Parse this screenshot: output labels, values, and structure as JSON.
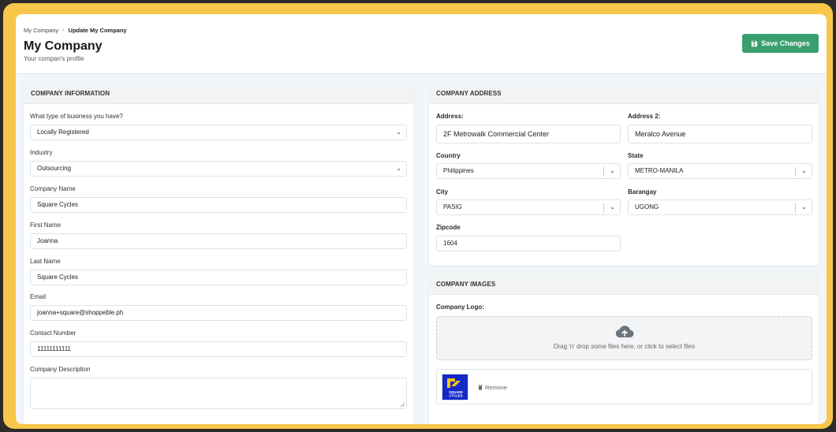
{
  "breadcrumb": {
    "root": "My Company",
    "separator": "›",
    "current": "Update My Company"
  },
  "header": {
    "title": "My Company",
    "subtitle": "Your compan's profile",
    "save_label": "Save Changes"
  },
  "company_info": {
    "heading": "COMPANY INFORMATION",
    "business_type": {
      "label": "What type of business you have?",
      "value": "Locally Registered"
    },
    "industry": {
      "label": "Industry",
      "value": "Outsourcing"
    },
    "company_name": {
      "label": "Company Name",
      "value": "Square Cycles"
    },
    "first_name": {
      "label": "First Name",
      "value": "Joanna"
    },
    "last_name": {
      "label": "Last Name",
      "value": "Square Cycles"
    },
    "email": {
      "label": "Email",
      "value": "joanna+square@shoppeble.ph"
    },
    "contact": {
      "label": "Contact Number",
      "value": "11111111111"
    },
    "description": {
      "label": "Company Description",
      "value": ""
    }
  },
  "address": {
    "heading": "COMPANY ADDRESS",
    "address1": {
      "label": "Address:",
      "value": "2F Metrowalk Commercial Center"
    },
    "address2": {
      "label": "Address 2:",
      "value": "Meralco Avenue"
    },
    "country": {
      "label": "Country",
      "value": "Philippines"
    },
    "state": {
      "label": "State",
      "value": "METRO-MANILA"
    },
    "city": {
      "label": "City",
      "value": "PASIG"
    },
    "barangay": {
      "label": "Barangay",
      "value": "UGONG"
    },
    "zipcode": {
      "label": "Zipcode",
      "value": "1604"
    }
  },
  "images": {
    "heading": "COMPANY IMAGES",
    "logo_label": "Company Logo:",
    "dropzone_text": "Drag 'n' drop some files here, or click to select files",
    "remove_label": "Remove",
    "logo_lines": [
      "SQUARE",
      "CYCLES"
    ]
  },
  "colors": {
    "accent": "#3a9f6f",
    "logo_bg": "#1529c8",
    "logo_mark": "#f5c518"
  }
}
